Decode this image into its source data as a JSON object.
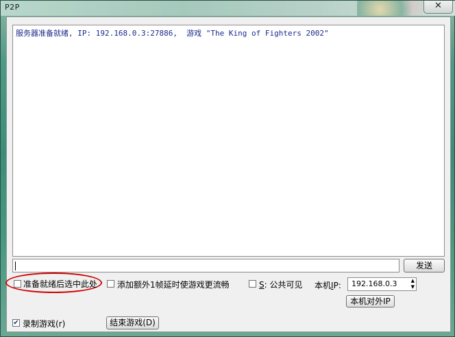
{
  "window": {
    "title": "P2P",
    "close_glyph": "✕"
  },
  "log": {
    "text": "服务器准备就绪, IP: 192.168.0.3:27886,  游戏 \"The King of Fighters 2002\""
  },
  "message_input": {
    "value": ""
  },
  "send_button": {
    "label": "发送"
  },
  "ready_checkbox": {
    "label": "准备就绪后选中此处",
    "checked": false
  },
  "extra_frame_checkbox": {
    "label": "添加额外1帧延时使游戏更流畅",
    "checked": false
  },
  "public_checkbox": {
    "mnemonic": "S",
    "label": ": 公共可见",
    "checked": false
  },
  "local_ip": {
    "label_prefix": "本机",
    "mnemonic": "I",
    "label_suffix": "P:",
    "value": "192.168.0.3"
  },
  "external_ip_button": {
    "label": "本机对外IP"
  },
  "record_checkbox": {
    "label": "录制游戏(r)",
    "checked": true,
    "check_glyph": "✔"
  },
  "end_game_button": {
    "label": "结束游戏(D)"
  },
  "colors": {
    "log_text": "#1a2a8c",
    "highlight_ring": "#d00000"
  }
}
